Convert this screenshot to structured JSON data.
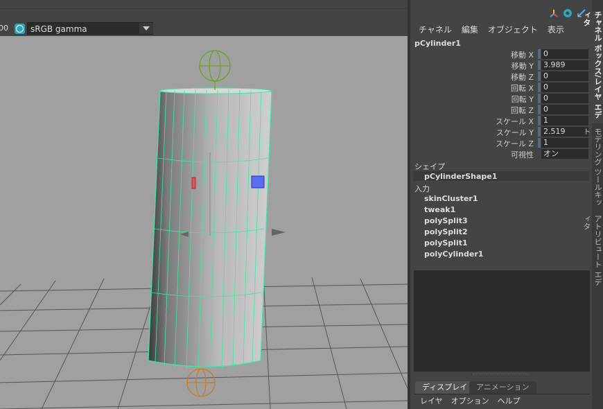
{
  "viewport": {
    "frame_value": "00",
    "color_management_icon": "color-management-icon",
    "color_space": "sRGB gamma",
    "grid": true
  },
  "panel": {
    "menu": [
      "チャネル",
      "編集",
      "オブジェクト",
      "表示"
    ],
    "node_name": "pCylinder1",
    "attributes": [
      {
        "label": "移動 X",
        "value": "0"
      },
      {
        "label": "移動 Y",
        "value": "3.989"
      },
      {
        "label": "移動 Z",
        "value": "0"
      },
      {
        "label": "回転 X",
        "value": "0"
      },
      {
        "label": "回転 Y",
        "value": "0"
      },
      {
        "label": "回転 Z",
        "value": "0"
      },
      {
        "label": "スケール X",
        "value": "1"
      },
      {
        "label": "スケール Y",
        "value": "2.519"
      },
      {
        "label": "スケール Z",
        "value": "1"
      },
      {
        "label": "可視性",
        "value": "オン"
      }
    ],
    "shape_header": "シェイプ",
    "shape_node": "pCylinderShape1",
    "input_header": "入力",
    "inputs": [
      "skinCluster1",
      "tweak1",
      "polySplit3",
      "polySplit2",
      "polySplit1",
      "polyCylinder1"
    ],
    "bottom_tabs": [
      "ディスプレイ",
      "アニメーション"
    ],
    "bottom_menu": [
      "レイヤ",
      "オプション",
      "ヘルプ"
    ]
  },
  "side_tabs": [
    "チャネル ボックス/レイヤ エディタ",
    "モデリング ツールキット",
    "アトリビュート エディタ"
  ]
}
